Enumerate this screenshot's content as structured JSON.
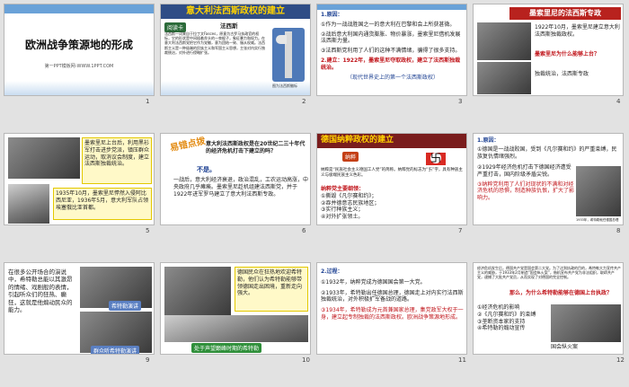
{
  "slides": [
    {
      "num": "1",
      "title": "欧洲战争策源地的形成",
      "subtitle": "第一PPT模板网-WWW.1PPT.COM"
    },
    {
      "num": "2",
      "title": "意大利法西斯政权的建立",
      "label": "阅读卡",
      "heading": "法西斯",
      "body": "法西斯一词来自于拉丁文Fasces，原意为古罗马执政官的权标，它的形状是中间插着斧头的一束棍子，象征暴力和权力。在意大利法西斯党把它作为党徽，意为团结一致、服从权威。法西斯主义是一种极端的民族主义和军国主义思想，主张对内实行独裁统治，对外进行侵略扩张。",
      "caption": "图为法西斯徽标"
    },
    {
      "num": "3",
      "items": [
        "1.原因：",
        "①作为一战战胜国之一的意大利在巴黎和会上所获甚微。",
        "②战后意大利国内通货膨胀、物价暴涨，墨索里尼借机发展法西斯力量。",
        "③法西斯党利用了人们的这种不满情绪，骗得了很多支持。",
        "2.建立：1922年，墨索里尼夺取政权，建立了法西斯独裁统治。",
        "（现代世界史上的第一个法西斯政权）"
      ]
    },
    {
      "num": "4",
      "title": "墨索里尼的法西斯专政",
      "text1": "1922年10月，墨索里尼建立意大利法西斯独裁政权。",
      "text2": "墨索里尼为什么能够上台？",
      "text3": "独裁统治，法西斯专政"
    },
    {
      "num": "5",
      "text1": "墨索里尼上台后，利用黑衫军打击进步党派，镇压群众运动，取消议会制度，建立法西斯独裁统治。",
      "text2": "1935年10月，墨索里尼悍然入侵阿比西尼亚，1936年5月，意大利军队占领埃塞俄比亚首都。"
    },
    {
      "num": "6",
      "title": "易错点拨",
      "question": "意大利法西斯政权是在20世纪二三十年代的经济危机打击下建立的吗？",
      "answer_label": "不是。",
      "answer": "一战后，意大利经济衰退，政治混乱，工农运动高涨，中央政府几乎瘫痪。墨索里尼趁机组建法西斯党，并于1922年进军罗马建立了意大利法西斯专政。"
    },
    {
      "num": "7",
      "title": "德国纳粹政权的建立",
      "badge": "纳粹",
      "body": "纳粹是“民族社会主义德国工人党”的简称。纳粹党的标志为“卐”字，具有种族主义与极端民族主义色彩。",
      "list": [
        "纳粹党主要纲领：",
        "①撕毁《凡尔赛和约》；",
        "②吞并德意志民族地区；",
        "③实行种族主义；",
        "④对外扩张领土。"
      ]
    },
    {
      "num": "8",
      "items": [
        "1.原因：",
        "①德国是一战战败国，受到《凡尔赛和约》的严重束缚，民族复仇情绪强烈。",
        "②1929年经济危机打击下德国经济遭受严重打击，国内阶级矛盾尖锐。",
        "③纳粹党利用了人们对现状的不满和对经济危机的恐惧，制造种族仇恨，扩大了影响力。"
      ],
      "caption": "1933年，希特勒就任德国总理"
    },
    {
      "num": "9",
      "text": "在很多公开场合的演说中，希特勒总能以其激昂的情绪、戏剧般的表情，引起听众们的狂热、癫狂，这就是他煽动民众的能力。",
      "chip1": "希特勒演讲",
      "chip2": "群众听希特勒演讲"
    },
    {
      "num": "10",
      "text": "德国民众在狂热地欢迎希特勒，他们认为希特勒能够带领德国走出困境，重新走向强大。",
      "banner": "处于声望巅峰时期的希特勒"
    },
    {
      "num": "11",
      "items": [
        "2.过程：",
        "①1932年，纳粹党成为德国国会第一大党。",
        "②1933年，希特勒出任德国总理，德国走上对内实行法西斯独裁统治，对外积极扩军备战的道路。",
        "③1934年，希特勒成为元首兼国家总理，集党政军大权于一身，建立起专制独裁的法西斯政权。欧洲战争策源地形成。"
      ]
    },
    {
      "num": "12",
      "body": "经济危机发生后，德国共产党是国会第二大党。为了达到执政的目的，希特勒大力宣传共产主义的威胁，于1933年2月制造“国会纵火案”，借机宣布共产党为非法组织，取缔共产党，逮捕了大批共产党员，从而实现了对德国的完全控制。",
      "question": "那么，为什么希特勒能够在德国上台执政？",
      "list": [
        "①经济危机的影响",
        "②《凡尔赛和约》的束缚",
        "③垄断资本家的支持",
        "④希特勒的煽动宣传"
      ],
      "caption": "国会纵火案"
    }
  ]
}
